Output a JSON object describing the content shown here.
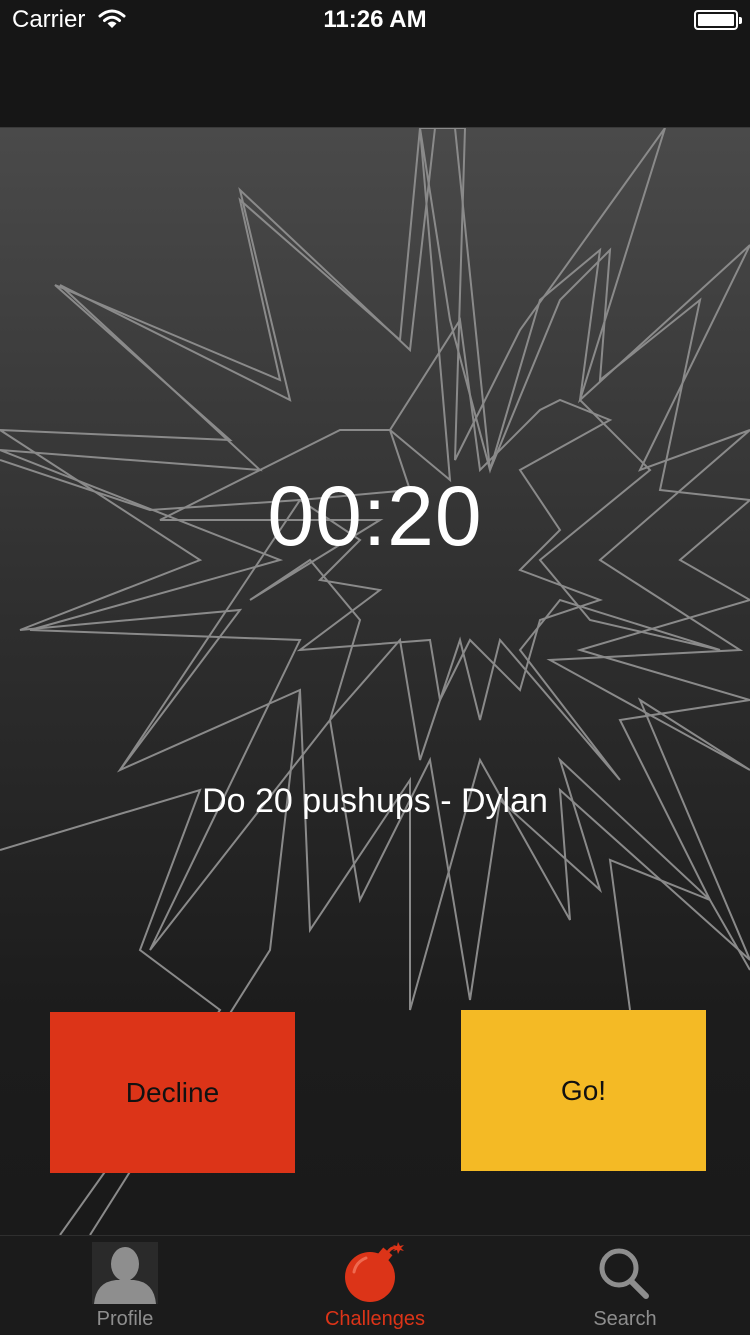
{
  "status_bar": {
    "carrier": "Carrier",
    "time": "11:26 AM"
  },
  "challenge": {
    "timer": "00:20",
    "description": "Do 20 pushups - Dylan"
  },
  "actions": {
    "decline_label": "Decline",
    "go_label": "Go!"
  },
  "tab_bar": {
    "items": [
      {
        "label": "Profile",
        "icon": "profile-icon"
      },
      {
        "label": "Challenges",
        "icon": "bomb-icon",
        "active": true
      },
      {
        "label": "Search",
        "icon": "search-icon"
      }
    ]
  },
  "colors": {
    "decline": "#dc3418",
    "go": "#f4ba25",
    "active_tab": "#dc3418",
    "inactive_tab": "#8e8e8e"
  }
}
